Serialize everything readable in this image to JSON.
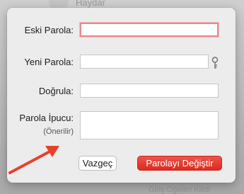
{
  "background": {
    "name": "Haydar",
    "bottom_text": "Giriş Öğeleri Kilidi"
  },
  "dialog": {
    "fields": {
      "old_password": {
        "label": "Eski Parola:",
        "value": ""
      },
      "new_password": {
        "label": "Yeni Parola:",
        "value": ""
      },
      "verify": {
        "label": "Doğrula:",
        "value": ""
      },
      "hint": {
        "label": "Parola İpucu:",
        "sublabel": "(Önerilir)",
        "value": ""
      }
    },
    "key_icon": "key-icon",
    "buttons": {
      "cancel": "Vazgeç",
      "change": "Parolayı Değiştir"
    }
  },
  "colors": {
    "primary_button": "#e2342a",
    "focus_ring": "#e58a8a",
    "annotation_arrow": "#e8412b"
  }
}
